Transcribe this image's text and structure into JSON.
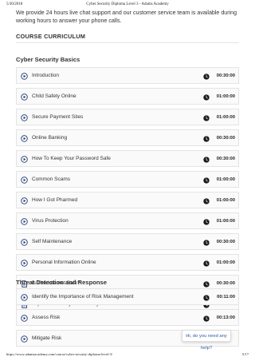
{
  "print_header": {
    "date": "5/30/2018",
    "document_title": "Cyber Security Diploma Level 3 - Adams Academy"
  },
  "intro_text": "We provide 24 hours live chat support and our customer service team is available during working hours to answer your phone calls.",
  "curriculum_heading": "COURSE CURRICULUM",
  "sections": [
    {
      "title": "Cyber Security Basics",
      "lessons": [
        {
          "icon": "play-circle-icon",
          "title": "Introduction",
          "duration": "00:30:00"
        },
        {
          "icon": "play-circle-icon",
          "title": "Child Safety Online",
          "duration": "01:00:00"
        },
        {
          "icon": "play-circle-icon",
          "title": "Secure Payment Sites",
          "duration": "01:00:00"
        },
        {
          "icon": "play-circle-icon",
          "title": "Online Banking",
          "duration": "00:30:00"
        },
        {
          "icon": "play-circle-icon",
          "title": "How To Keep Your Password Safe",
          "duration": "00:30:00"
        },
        {
          "icon": "play-circle-icon",
          "title": "Common Scams",
          "duration": "01:00:00"
        },
        {
          "icon": "play-circle-icon",
          "title": "How I Got Pharmed",
          "duration": "01:00:00"
        },
        {
          "icon": "play-circle-icon",
          "title": "Virus Protection",
          "duration": "01:00:00"
        },
        {
          "icon": "play-circle-icon",
          "title": "Self Maintenance",
          "duration": "00:30:00"
        },
        {
          "icon": "play-circle-icon",
          "title": "Personal Information Online",
          "duration": "01:00:00"
        },
        {
          "icon": "document-icon",
          "title": "Is The Internet Safe?",
          "duration": "00:30:00"
        },
        {
          "icon": "document-icon",
          "title": "Importance of Cyber Security",
          "duration": "00:30:00"
        }
      ]
    },
    {
      "title": "Threat Detection and Response",
      "lessons": [
        {
          "icon": "play-circle-icon",
          "title": "Identify the Importance of Risk Management",
          "duration": "00:11:00"
        },
        {
          "icon": "play-circle-icon",
          "title": "Assess Risk",
          "duration": "00:13:00"
        },
        {
          "icon": "play-circle-icon",
          "title": "Mitigate Risk",
          "duration": ""
        }
      ]
    }
  ],
  "chat_widget": {
    "label": "Hi, do you need any help?"
  },
  "print_footer": {
    "url": "https://www.adamsacademy.com/course/cyber-security-diploma-level-3/",
    "page": "5/17"
  },
  "colors": {
    "accent": "#1f3b73",
    "row_bg": "#fafafa",
    "border": "#e4e4e4"
  }
}
